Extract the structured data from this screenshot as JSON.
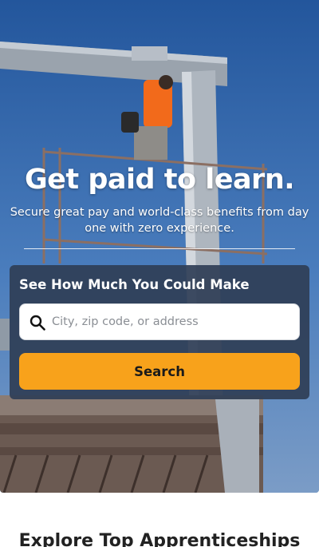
{
  "hero": {
    "headline": "Get paid to learn.",
    "subhead": "Secure great pay and world-class benefits from day one with zero experience."
  },
  "search_card": {
    "title": "See How Much You Could Make",
    "input_placeholder": "City, zip code, or address",
    "input_value": "",
    "button_label": "Search"
  },
  "explore": {
    "title": "Explore Top Apprenticeships"
  },
  "colors": {
    "accent": "#f8a21b",
    "card_background": "#2f3e56",
    "sky": "#3a6fb2"
  },
  "icons": {
    "search": "magnifier-icon"
  }
}
